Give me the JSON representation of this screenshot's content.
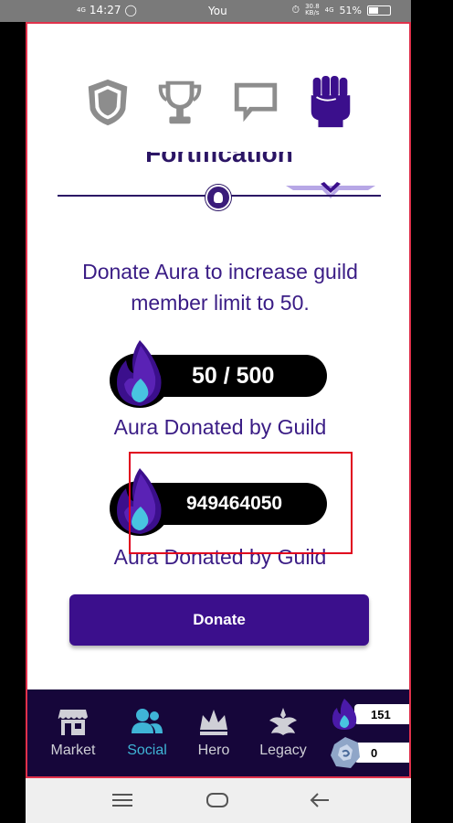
{
  "status_bar": {
    "signal": "4G",
    "time": "14:27",
    "carrier": "You",
    "speed": "30.8",
    "speed_unit": "KB/s",
    "network": "4G",
    "battery": "51%"
  },
  "tabs": [
    {
      "name": "shield-icon",
      "active": false
    },
    {
      "name": "trophy-icon",
      "active": false
    },
    {
      "name": "chat-icon",
      "active": false
    },
    {
      "name": "fist-icon",
      "active": true
    }
  ],
  "section_title": "Fortification",
  "description": "Donate Aura to increase guild member limit to 50.",
  "progress_1": {
    "value_text": "50 / 500",
    "label": "Aura Donated by Guild"
  },
  "progress_2": {
    "value_text": "949464050",
    "label": "Aura Donated by Guild"
  },
  "donate_button": "Donate",
  "bottom_nav": [
    {
      "label": "Market",
      "icon": "market-icon"
    },
    {
      "label": "Social",
      "icon": "social-icon",
      "active": true
    },
    {
      "label": "Hero",
      "icon": "crown-icon"
    },
    {
      "label": "Legacy",
      "icon": "legacy-icon"
    }
  ],
  "resources": {
    "aura": "151",
    "gems": "0"
  },
  "colors": {
    "primary": "#3b0f8c",
    "text_purple": "#3a1c85",
    "nav_bg": "#16063a",
    "active_nav": "#3fb4d6",
    "highlight": "#e0001e"
  }
}
